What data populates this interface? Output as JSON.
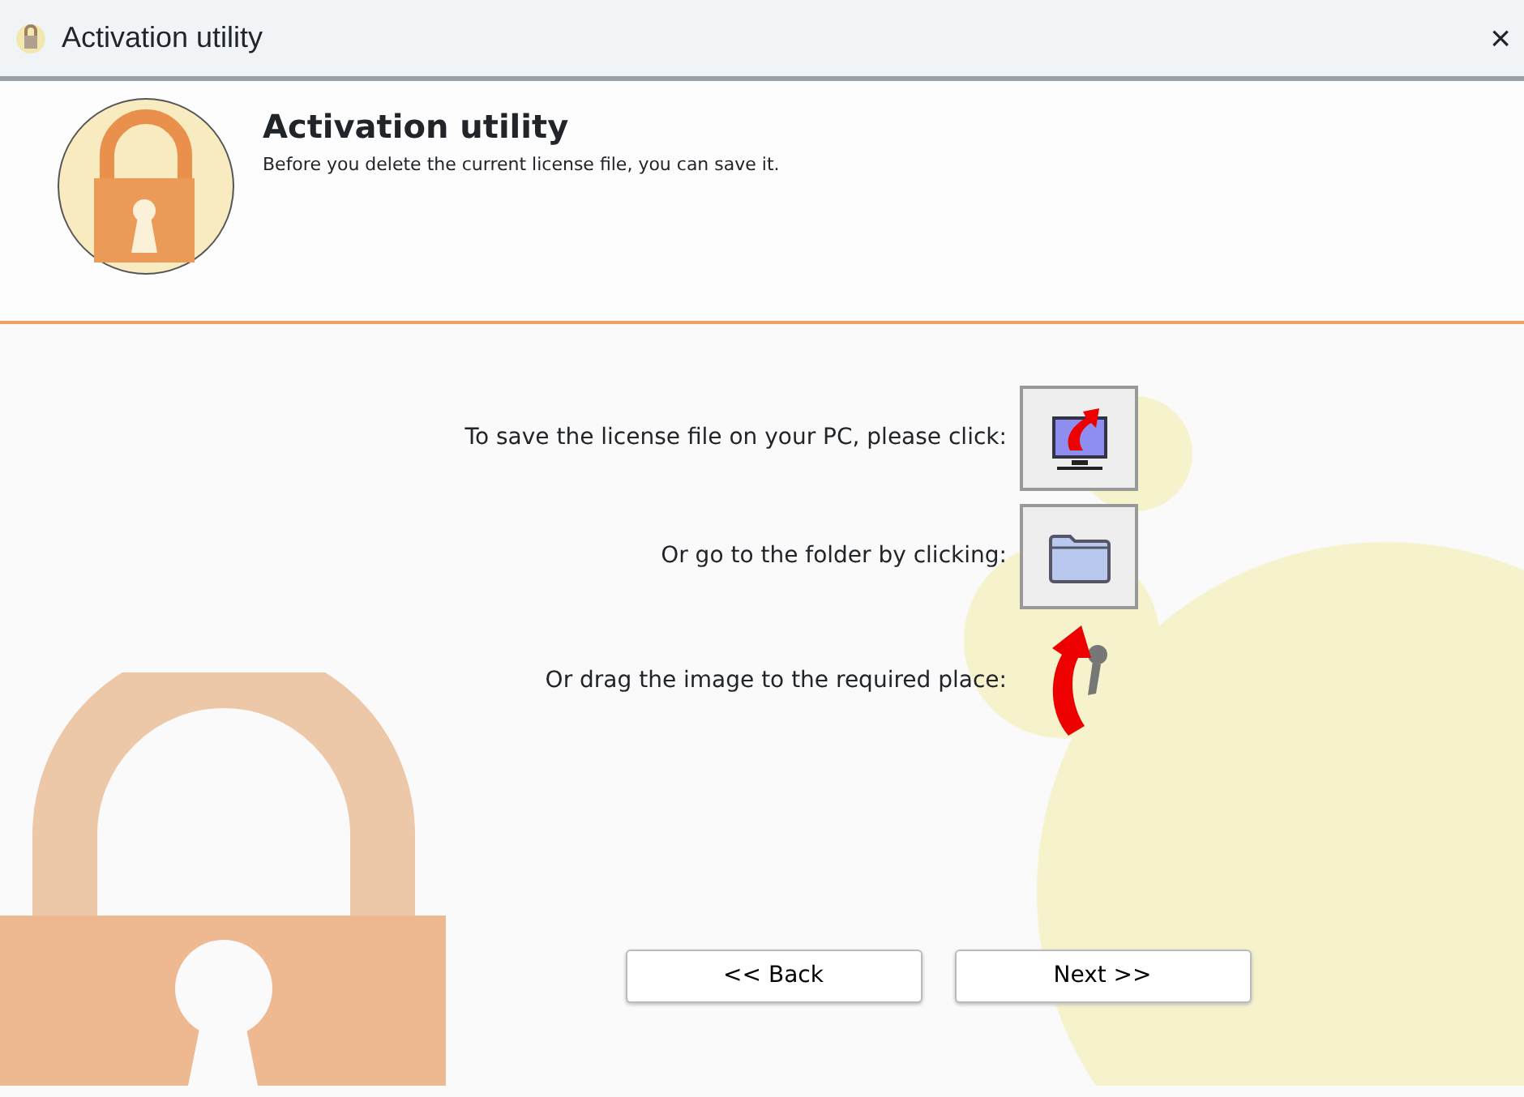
{
  "window": {
    "title": "Activation utility",
    "close": "×"
  },
  "header": {
    "title": "Activation utility",
    "subtitle": "Before you delete the current license file, you can save it."
  },
  "actions": [
    {
      "label": "To save the license file on your PC, please click:",
      "kind": "save"
    },
    {
      "label": "Or go to the folder by clicking:",
      "kind": "folder"
    },
    {
      "label": "Or drag the image to the required place:",
      "kind": "drag"
    }
  ],
  "buttons": [
    "<< Back",
    "Next >>"
  ]
}
